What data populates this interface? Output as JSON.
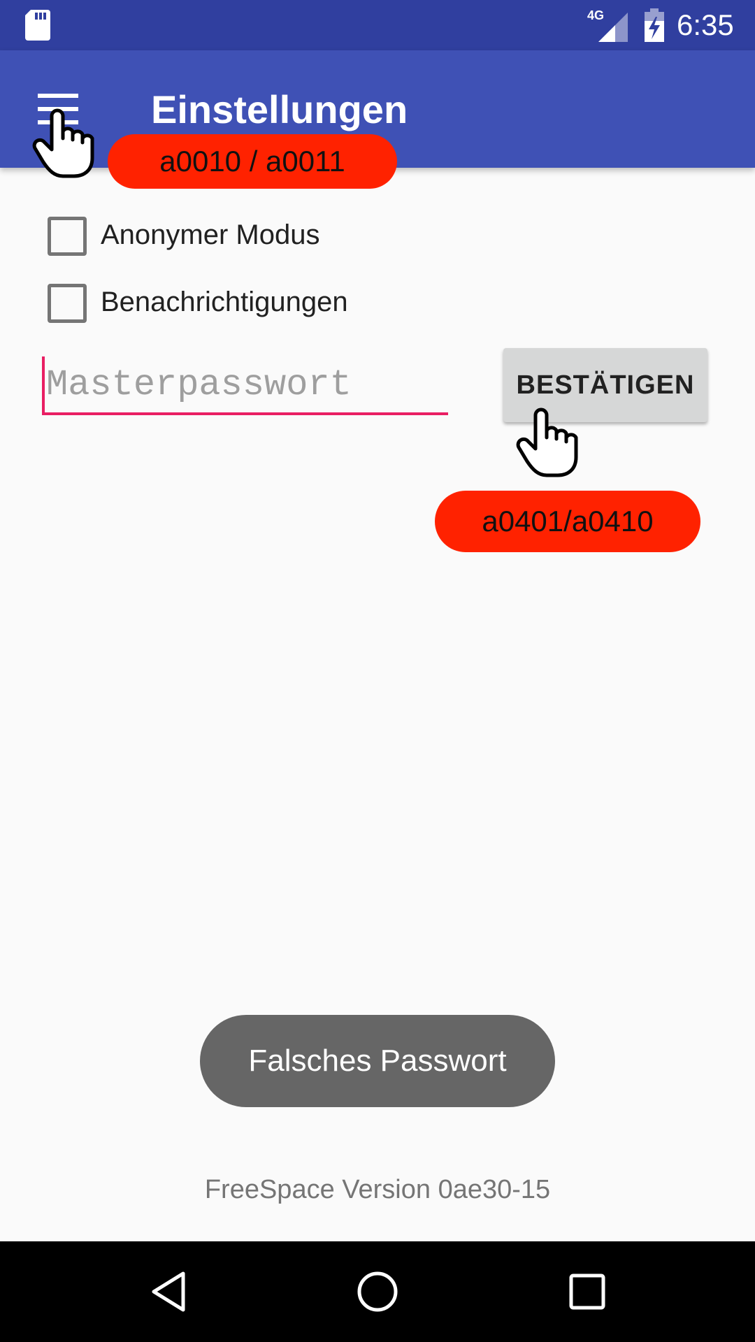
{
  "status_bar": {
    "time": "6:35",
    "network_label": "4G",
    "icons": [
      "sd-card-icon",
      "signal-icon",
      "battery-charging-icon"
    ]
  },
  "toolbar": {
    "title": "Einstellungen",
    "menu_icon": "menu-icon",
    "color": "#3f51b5",
    "status_color": "#303f9f"
  },
  "settings": {
    "checkboxes": [
      {
        "label": "Anonymer Modus",
        "checked": false
      },
      {
        "label": "Benachrichtigungen",
        "checked": false
      }
    ],
    "password": {
      "placeholder": "Masterpasswort",
      "value": "",
      "accent_color": "#e91e63"
    },
    "confirm_label": "BESTÄTIGEN"
  },
  "annotations": [
    {
      "label": "a0010 / a0011",
      "icon": "hand-pointer-icon"
    },
    {
      "label": "a0401/a0410",
      "icon": "hand-pointer-icon"
    }
  ],
  "annotation_color": "#ff2200",
  "toast": {
    "message": "Falsches Passwort"
  },
  "footer": {
    "version": "FreeSpace Version 0ae30-15"
  },
  "nav_bar": {
    "icons": [
      "back-icon",
      "home-icon",
      "recents-icon"
    ]
  }
}
